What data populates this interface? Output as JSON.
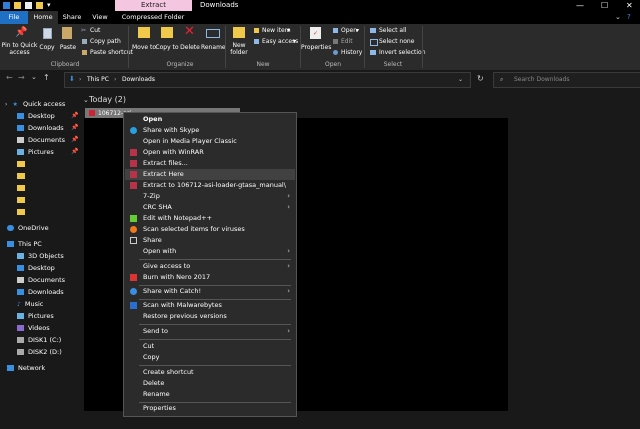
{
  "window": {
    "context_tab": "Extract",
    "title": "Downloads"
  },
  "tabs": {
    "file": "File",
    "home": "Home",
    "share": "Share",
    "view": "View",
    "compressed": "Compressed Folder Tools"
  },
  "ribbon": {
    "pin": "Pin to Quick access",
    "copy": "Copy",
    "paste": "Paste",
    "cut": "Cut",
    "copy_path": "Copy path",
    "paste_shortcut": "Paste shortcut",
    "clipboard_group": "Clipboard",
    "move_to": "Move to",
    "copy_to": "Copy to",
    "delete": "Delete",
    "rename": "Rename",
    "organize_group": "Organize",
    "new_folder": "New folder",
    "new_item": "New item",
    "easy_access": "Easy access",
    "new_group": "New",
    "properties": "Properties",
    "open": "Open",
    "edit": "Edit",
    "history": "History",
    "open_group": "Open",
    "select_all": "Select all",
    "select_none": "Select none",
    "invert_selection": "Invert selection",
    "select_group": "Select"
  },
  "address": {
    "path": [
      "This PC",
      "Downloads"
    ],
    "search_placeholder": "Search Downloads"
  },
  "nav": {
    "quick_access": "Quick access",
    "desktop": "Desktop",
    "downloads": "Downloads",
    "documents": "Documents",
    "pictures": "Pictures",
    "onedrive": "OneDrive",
    "this_pc": "This PC",
    "objects3d": "3D Objects",
    "desktop2": "Desktop",
    "documents2": "Documents",
    "downloads2": "Downloads",
    "music": "Music",
    "pictures2": "Pictures",
    "videos": "Videos",
    "disk1": "DISK1 (C:)",
    "disk2": "DISK2 (D:)",
    "network": "Network"
  },
  "content": {
    "group_header": "Today (2)",
    "selected_file": "106712-asi"
  },
  "context_menu": [
    {
      "label": "Open"
    },
    {
      "label": "Share with Skype"
    },
    {
      "label": "Open in Media Player Classic"
    },
    {
      "label": "Open with WinRAR"
    },
    {
      "label": "Extract files..."
    },
    {
      "label": "Extract Here"
    },
    {
      "label": "Extract to 106712-asi-loader-gtasa_manual\\"
    },
    {
      "label": "7-Zip"
    },
    {
      "label": "CRC SHA"
    },
    {
      "label": "Edit with Notepad++"
    },
    {
      "label": "Scan selected items for viruses"
    },
    {
      "label": "Share"
    },
    {
      "label": "Open with"
    },
    {
      "label": "Give access to"
    },
    {
      "label": "Burn with Nero 2017"
    },
    {
      "label": "Share with Catch!"
    },
    {
      "label": "Scan with Malwarebytes"
    },
    {
      "label": "Restore previous versions"
    },
    {
      "label": "Send to"
    },
    {
      "label": "Cut"
    },
    {
      "label": "Copy"
    },
    {
      "label": "Create shortcut"
    },
    {
      "label": "Delete"
    },
    {
      "label": "Rename"
    },
    {
      "label": "Properties"
    }
  ],
  "colors": {
    "accent": "#1f6fc5",
    "context_tab": "#f4c6e0",
    "folder": "#f0c84c",
    "menu_bg": "#2b2b2b"
  }
}
